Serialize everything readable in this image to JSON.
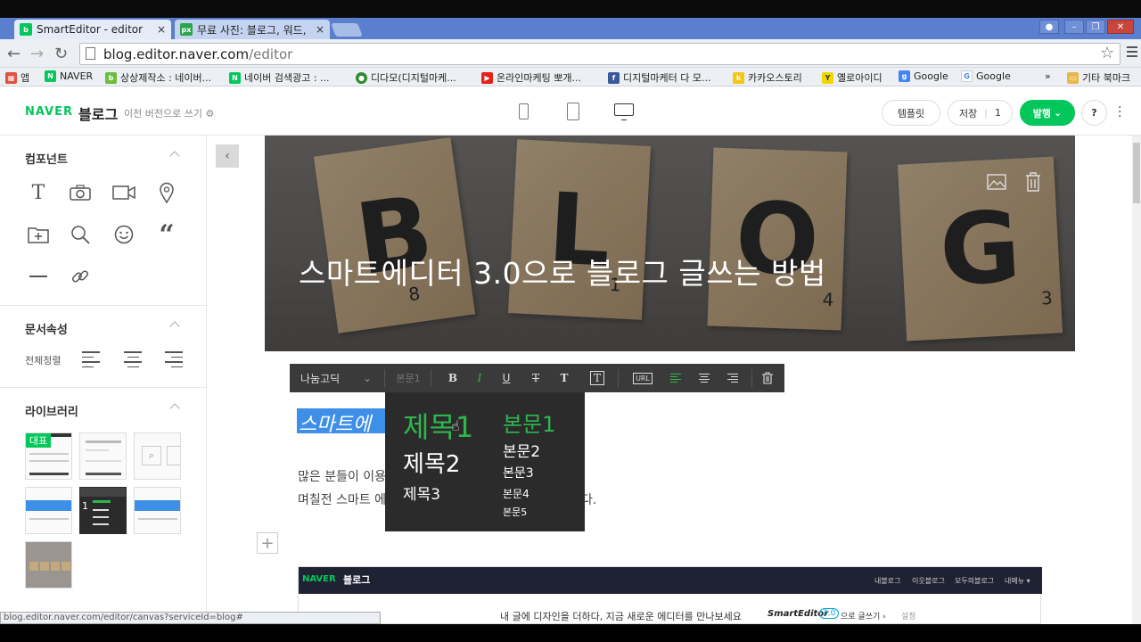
{
  "browser": {
    "tabs": [
      {
        "title": "SmartEditor - editor",
        "favicon": "blog",
        "close": "×",
        "active": true
      },
      {
        "title": "무료 사진: 블로그, 워드, ",
        "favicon": "px",
        "close": "×",
        "active": false
      }
    ],
    "url_domain": "blog.editor.naver.com",
    "url_path": "/editor",
    "window_buttons": [
      "person-icon",
      "minimize-icon",
      "restore-icon",
      "close-icon"
    ],
    "bookmarks": [
      {
        "label": "앱",
        "icon": "apps-icon"
      },
      {
        "label": "NAVER",
        "icon": "naver-icon"
      },
      {
        "label": "상상제작소 : 네이버...",
        "icon": "blog-icon"
      },
      {
        "label": "네이버 검색광고 : ...",
        "icon": "naver-icon"
      },
      {
        "label": "디다모(디지털마케...",
        "icon": "circle-icon"
      },
      {
        "label": "온라인마케팅 뽀개...",
        "icon": "youtube-icon"
      },
      {
        "label": "디지털마케터 다 모...",
        "icon": "facebook-icon"
      },
      {
        "label": "카카오스토리",
        "icon": "kakao-icon"
      },
      {
        "label": "옐로아이디",
        "icon": "yellow-icon"
      },
      {
        "label": "Google",
        "icon": "google-icon"
      },
      {
        "label": "Google",
        "icon": "google-icon"
      },
      {
        "label": "»",
        "icon": ""
      },
      {
        "label": "기타 북마크",
        "icon": "folder-icon"
      }
    ],
    "status_url": "blog.editor.naver.com/editor/canvas?serviceId=blog#"
  },
  "header": {
    "logo": "NAVER",
    "logo_blog": "블로그",
    "prev_version": "이전 버전으로 쓰기",
    "template": "템플릿",
    "save": "저장",
    "save_count": "1",
    "publish": "발행",
    "help": "?"
  },
  "sidebar": {
    "components_title": "컴포넌트",
    "components": [
      "text-icon",
      "camera-icon",
      "video-icon",
      "location-icon",
      "folder-add-icon",
      "search-icon",
      "emoji-icon",
      "quote-icon",
      "divider-icon",
      "link-icon"
    ],
    "doc_props_title": "문서속성",
    "align_all": "전체정렬",
    "library_title": "라이브러리",
    "library_badge": "대표"
  },
  "editor": {
    "hero_title": "스마트에디터 3.0으로 블로그 글쓰는 방법",
    "tile_letters": [
      "B",
      "L",
      "O",
      "G"
    ],
    "tile_numbers": [
      "8",
      "1",
      "4",
      "3"
    ],
    "font_name": "나눔고딕",
    "style_name": "본문1",
    "format_buttons": [
      "B",
      "I",
      "U",
      "T",
      "T",
      "T",
      "URL"
    ],
    "selected_text": "스마트에",
    "para1": "많은 분들이 이용",
    "para2": "며칠전 스마트 에",
    "para2_tail": "다.",
    "dropdown": {
      "left": [
        "제목1",
        "제목2",
        "제목3"
      ],
      "right": [
        "본문1",
        "본문2",
        "본문3",
        "본문4",
        "본문5"
      ]
    },
    "plus": "+"
  },
  "embed": {
    "logo": "NAVER",
    "logo_blog": "블로그",
    "nav": [
      "내블로그",
      "이웃블로그",
      "모두의블로그",
      "내메뉴 ▾"
    ],
    "banner": "내 글에 디자인을 더하다, 지금 새로운 에디터를 만나보세요",
    "brand": "SmartEditor",
    "version": "3.0",
    "cta": "으로 글쓰기 ›",
    "settings": "설정"
  },
  "colors": {
    "naver_green": "#03c75a",
    "tab_strip": "#5a7fcf",
    "selection": "#3d8fe8",
    "dropdown_green": "#2db84d"
  }
}
